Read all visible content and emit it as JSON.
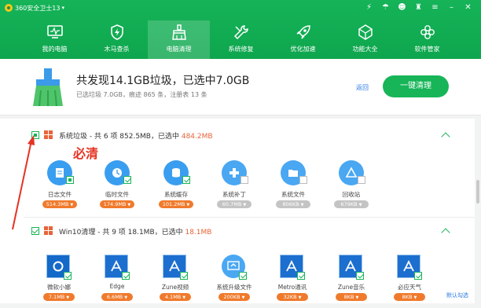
{
  "titlebar": {
    "title": "360安全卫士13",
    "version_mark": "▾"
  },
  "nav": [
    {
      "label": "我的电脑",
      "icon": "monitor-icon"
    },
    {
      "label": "木马查杀",
      "icon": "shield-bolt-icon"
    },
    {
      "label": "电脑清理",
      "icon": "broom-icon"
    },
    {
      "label": "系统修复",
      "icon": "wrench-icon"
    },
    {
      "label": "优化加速",
      "icon": "rocket-icon"
    },
    {
      "label": "功能大全",
      "icon": "diamond-icon"
    },
    {
      "label": "软件管家",
      "icon": "grid-icon"
    }
  ],
  "summary": {
    "title": "共发现14.1GB垃圾，已选中7.0GB",
    "subtitle": "已选垃圾 7.0GB，痕迹 865 条，注册表 13 条",
    "back_label": "返回",
    "clean_button": "一键清理"
  },
  "groups": [
    {
      "title_prefix": "系统垃圾 - 共 6 项 852.5MB，已选中 ",
      "selected": "484.2MB",
      "items": [
        {
          "label": "日志文件",
          "size": "514.3MB",
          "checked": "partial",
          "icon": "log-file-icon"
        },
        {
          "label": "临时文件",
          "size": "174.9MB",
          "checked": "checked",
          "icon": "clock-icon"
        },
        {
          "label": "系统缓存",
          "size": "101.2MB",
          "checked": "checked",
          "icon": "database-icon"
        },
        {
          "label": "系统补丁",
          "size": "60.7MB",
          "checked": "empty",
          "icon": "puzzle-icon"
        },
        {
          "label": "系统文件",
          "size": "806KB",
          "checked": "empty",
          "icon": "folder-icon"
        },
        {
          "label": "回收站",
          "size": "679KB",
          "checked": "empty",
          "icon": "recycle-icon"
        }
      ]
    },
    {
      "title_prefix": "Win10清理 - 共 9 项 18.1MB，已选中 ",
      "selected": "18.1MB",
      "items": [
        {
          "label": "微软小娜",
          "size": "7.1MB"
        },
        {
          "label": "Edge",
          "size": "6.6MB"
        },
        {
          "label": "Zune视频",
          "size": "4.1MB"
        },
        {
          "label": "系统升级文件",
          "size": "200KB"
        },
        {
          "label": "Metro通讯",
          "size": "32KB"
        },
        {
          "label": "Zune音乐",
          "size": "8KB"
        },
        {
          "label": "必应天气",
          "size": "8KB"
        }
      ]
    }
  ],
  "annotation": "必清",
  "default_select": "默认勾选",
  "colors": {
    "brand_green": "#17b558",
    "accent_orange": "#e8643a",
    "link_blue": "#2a7ae2",
    "annotation_red": "#e53222"
  }
}
